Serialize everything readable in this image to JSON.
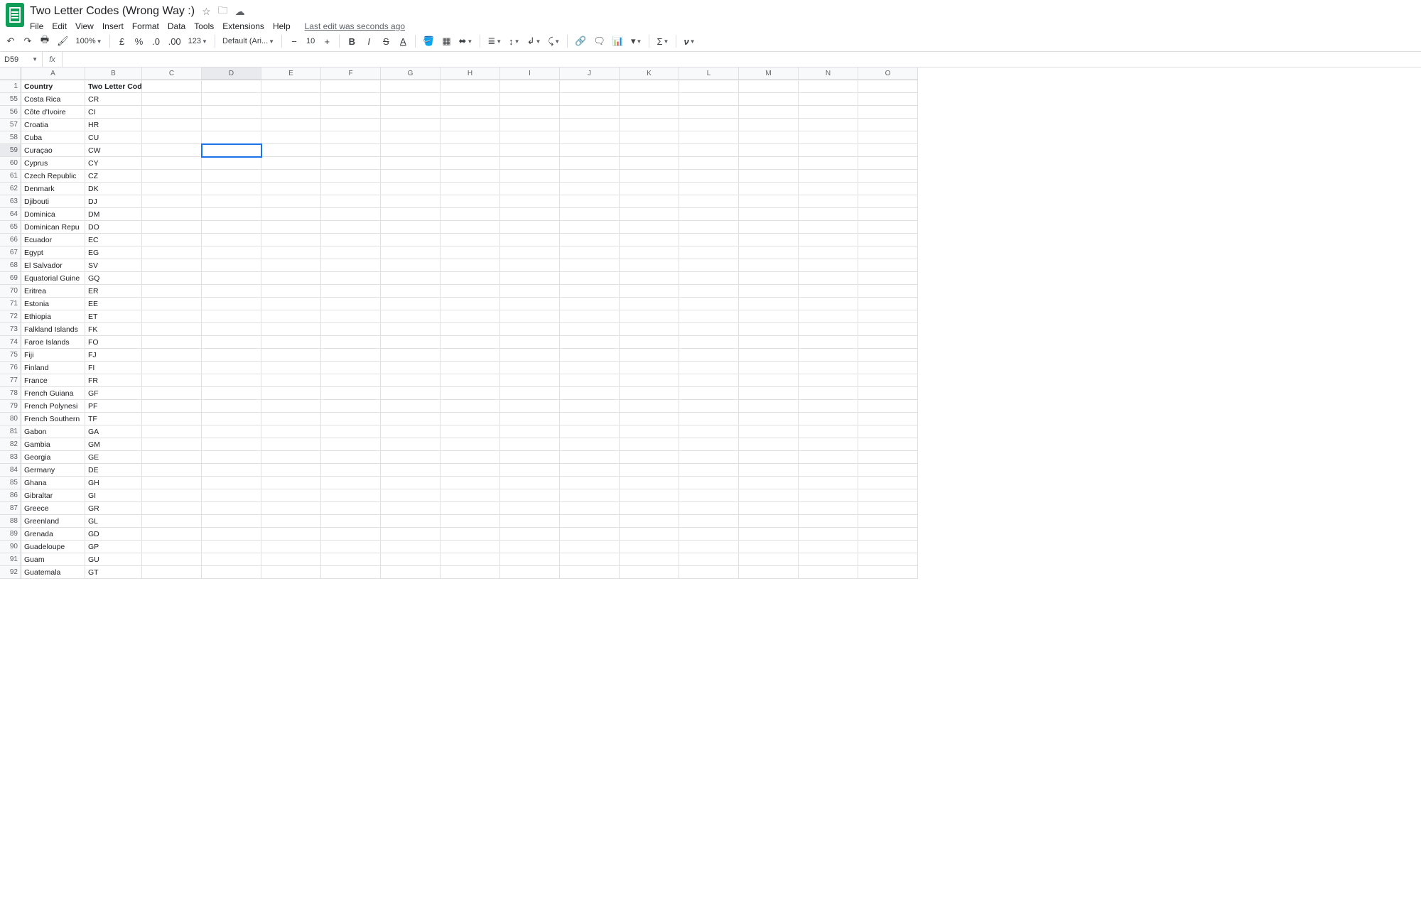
{
  "doc": {
    "title": "Two Letter Codes (Wrong Way :)",
    "last_edit": "Last edit was seconds ago"
  },
  "menus": [
    "File",
    "Edit",
    "View",
    "Insert",
    "Format",
    "Data",
    "Tools",
    "Extensions",
    "Help"
  ],
  "toolbar": {
    "zoom": "100%",
    "currency": "£",
    "percent": "%",
    "dec_dec": ".0",
    "inc_dec": ".00",
    "num_format": "123",
    "font": "Default (Ari...",
    "font_size": "10"
  },
  "name_box": "D59",
  "selected_cell": {
    "col": "D",
    "row_label": "59",
    "row_index": 5
  },
  "columns": [
    "A",
    "B",
    "C",
    "D",
    "E",
    "F",
    "G",
    "H",
    "I",
    "J",
    "K",
    "L",
    "M",
    "N",
    "O"
  ],
  "header_row": {
    "label": "1",
    "a": "Country",
    "b": "Two Letter Code"
  },
  "rows": [
    {
      "label": "55",
      "a": "Costa Rica",
      "b": "CR"
    },
    {
      "label": "56",
      "a": "Côte d'Ivoire",
      "b": "CI"
    },
    {
      "label": "57",
      "a": "Croatia",
      "b": "HR"
    },
    {
      "label": "58",
      "a": "Cuba",
      "b": "CU"
    },
    {
      "label": "59",
      "a": "Curaçao",
      "b": "CW"
    },
    {
      "label": "60",
      "a": "Cyprus",
      "b": "CY"
    },
    {
      "label": "61",
      "a": "Czech Republic",
      "b": "CZ"
    },
    {
      "label": "62",
      "a": "Denmark",
      "b": "DK"
    },
    {
      "label": "63",
      "a": "Djibouti",
      "b": "DJ"
    },
    {
      "label": "64",
      "a": "Dominica",
      "b": "DM"
    },
    {
      "label": "65",
      "a": "Dominican Repu",
      "b": "DO"
    },
    {
      "label": "66",
      "a": "Ecuador",
      "b": "EC"
    },
    {
      "label": "67",
      "a": "Egypt",
      "b": "EG"
    },
    {
      "label": "68",
      "a": "El Salvador",
      "b": "SV"
    },
    {
      "label": "69",
      "a": "Equatorial Guine",
      "b": "GQ"
    },
    {
      "label": "70",
      "a": "Eritrea",
      "b": "ER"
    },
    {
      "label": "71",
      "a": "Estonia",
      "b": "EE"
    },
    {
      "label": "72",
      "a": "Ethiopia",
      "b": "ET"
    },
    {
      "label": "73",
      "a": "Falkland Islands",
      "b": "FK"
    },
    {
      "label": "74",
      "a": "Faroe Islands",
      "b": "FO"
    },
    {
      "label": "75",
      "a": "Fiji",
      "b": "FJ"
    },
    {
      "label": "76",
      "a": "Finland",
      "b": "FI"
    },
    {
      "label": "77",
      "a": "France",
      "b": "FR"
    },
    {
      "label": "78",
      "a": "French Guiana",
      "b": "GF"
    },
    {
      "label": "79",
      "a": "French Polynesi",
      "b": "PF"
    },
    {
      "label": "80",
      "a": "French Southern",
      "b": "TF"
    },
    {
      "label": "81",
      "a": "Gabon",
      "b": "GA"
    },
    {
      "label": "82",
      "a": "Gambia",
      "b": "GM"
    },
    {
      "label": "83",
      "a": "Georgia",
      "b": "GE"
    },
    {
      "label": "84",
      "a": "Germany",
      "b": "DE"
    },
    {
      "label": "85",
      "a": "Ghana",
      "b": "GH"
    },
    {
      "label": "86",
      "a": "Gibraltar",
      "b": "GI"
    },
    {
      "label": "87",
      "a": "Greece",
      "b": "GR"
    },
    {
      "label": "88",
      "a": "Greenland",
      "b": "GL"
    },
    {
      "label": "89",
      "a": "Grenada",
      "b": "GD"
    },
    {
      "label": "90",
      "a": "Guadeloupe",
      "b": "GP"
    },
    {
      "label": "91",
      "a": "Guam",
      "b": "GU"
    },
    {
      "label": "92",
      "a": "Guatemala",
      "b": "GT"
    }
  ]
}
